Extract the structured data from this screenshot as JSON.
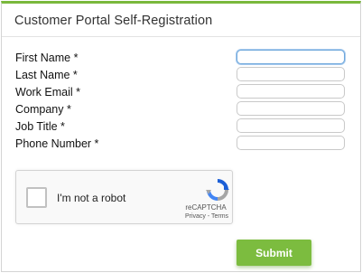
{
  "page": {
    "title": "Customer Portal Self-Registration",
    "accent_color": "#7ab83c"
  },
  "form": {
    "fields": [
      {
        "label": "First Name *",
        "value": "",
        "focused": true
      },
      {
        "label": "Last Name *",
        "value": ""
      },
      {
        "label": "Work Email *",
        "value": ""
      },
      {
        "label": "Company *",
        "value": ""
      },
      {
        "label": "Job Title *",
        "value": ""
      },
      {
        "label": "Phone Number *",
        "value": ""
      }
    ]
  },
  "captcha": {
    "label": "I'm not a robot",
    "brand": "reCAPTCHA",
    "terms": "Privacy - Terms",
    "icon": "recaptcha-logo-icon"
  },
  "submit": {
    "label": "Submit",
    "color": "#7cbc3f"
  }
}
